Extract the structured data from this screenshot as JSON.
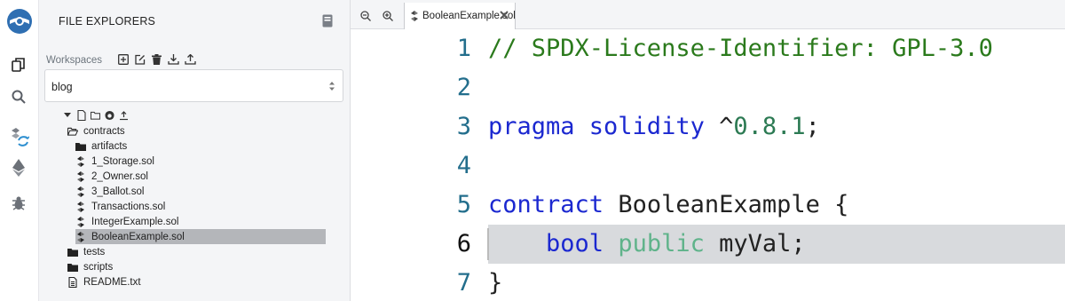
{
  "sidebar_icons": [
    "remix-logo-icon",
    "files-icon",
    "search-icon",
    "compile-icon",
    "deploy-icon",
    "debug-icon"
  ],
  "explorer": {
    "title": "FILE EXPLORERS",
    "workspaces_label": "Workspaces",
    "workspace_icons": [
      "plus-square-icon",
      "edit-icon",
      "trash-icon",
      "download-icon",
      "upload-cloud-icon"
    ],
    "workspace_selected": "blog",
    "tree_tool_icons": [
      "caret-down-icon",
      "new-file-icon",
      "new-folder-icon",
      "github-icon",
      "upload-icon"
    ],
    "tree": [
      {
        "label": "contracts",
        "type": "folder-open",
        "indent": 1
      },
      {
        "label": "artifacts",
        "type": "folder",
        "indent": 2
      },
      {
        "label": "1_Storage.sol",
        "type": "sol",
        "indent": 2
      },
      {
        "label": "2_Owner.sol",
        "type": "sol",
        "indent": 2
      },
      {
        "label": "3_Ballot.sol",
        "type": "sol",
        "indent": 2
      },
      {
        "label": "Transactions.sol",
        "type": "sol",
        "indent": 2
      },
      {
        "label": "IntegerExample.sol",
        "type": "sol",
        "indent": 2
      },
      {
        "label": "BooleanExample.sol",
        "type": "sol",
        "indent": 2,
        "selected": true
      },
      {
        "label": "tests",
        "type": "folder",
        "indent": 1
      },
      {
        "label": "scripts",
        "type": "folder",
        "indent": 1
      },
      {
        "label": "README.txt",
        "type": "file",
        "indent": 1
      }
    ]
  },
  "editor": {
    "tab_label": "BooleanExample.sol",
    "active_line": 6,
    "lines": [
      {
        "n": "1",
        "tokens": [
          {
            "t": "// SPDX-License-Identifier: GPL-3.0",
            "c": "c-comment"
          }
        ]
      },
      {
        "n": "2",
        "tokens": []
      },
      {
        "n": "3",
        "tokens": [
          {
            "t": "pragma solidity ",
            "c": "c-kw"
          },
          {
            "t": "^",
            "c": "c-id"
          },
          {
            "t": "0.8.1",
            "c": "c-num"
          },
          {
            "t": ";",
            "c": "c-id"
          }
        ]
      },
      {
        "n": "4",
        "tokens": []
      },
      {
        "n": "5",
        "tokens": [
          {
            "t": "contract ",
            "c": "c-kw"
          },
          {
            "t": "BooleanExample {",
            "c": "c-id"
          }
        ]
      },
      {
        "n": "6",
        "tokens": [
          {
            "t": "    bool ",
            "c": "c-kw"
          },
          {
            "t": "public ",
            "c": "c-pub"
          },
          {
            "t": "myVal;",
            "c": "c-id"
          }
        ]
      },
      {
        "n": "7",
        "tokens": [
          {
            "t": "}",
            "c": "c-id"
          }
        ]
      }
    ]
  }
}
